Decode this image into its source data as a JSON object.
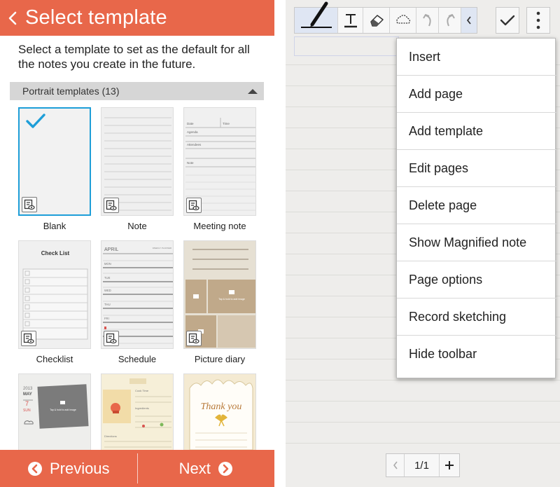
{
  "left": {
    "header": {
      "title": "Select template"
    },
    "description": "Select a template to set as the default for all the notes you create in the future.",
    "section": {
      "label": "Portrait templates (13)"
    },
    "templates": [
      {
        "label": "Blank"
      },
      {
        "label": "Note"
      },
      {
        "label": "Meeting note"
      },
      {
        "label": "Checklist"
      },
      {
        "label": "Schedule"
      },
      {
        "label": "Picture diary"
      }
    ],
    "thumbs": {
      "meeting": {
        "date": "Date",
        "time": "Time",
        "agenda": "Agenda",
        "attendees": "Attendees",
        "note": "Note"
      },
      "checklist": {
        "title": "Check List"
      },
      "schedule": {
        "month": "APRIL",
        "tag": "WEEKLY PLANNER",
        "days": [
          "MON",
          "TUE",
          "WED",
          "THU",
          "FRI"
        ]
      },
      "diary": {
        "hint": "Tap & hold to add image"
      },
      "calendar": {
        "year": "2013",
        "month": "MAY",
        "day": "7",
        "weekday": "SUN",
        "hint": "Tap & hold to add image"
      },
      "recipe": {
        "cook": "Cook Time",
        "ingredients": "Ingredients",
        "directions": "Directions"
      },
      "thanks": {
        "text": "Thank you"
      }
    },
    "footer": {
      "previous": "Previous",
      "next": "Next"
    }
  },
  "right": {
    "menu": [
      "Insert",
      "Add page",
      "Add template",
      "Edit pages",
      "Delete page",
      "Show Magnified note",
      "Page options",
      "Record sketching",
      "Hide toolbar"
    ],
    "pager": {
      "page": "1/1"
    }
  },
  "colors": {
    "accent": "#e8674a",
    "selection": "#1e9ed8",
    "paper": "#eeedeb",
    "toolbar_active": "#dfe6f3"
  }
}
